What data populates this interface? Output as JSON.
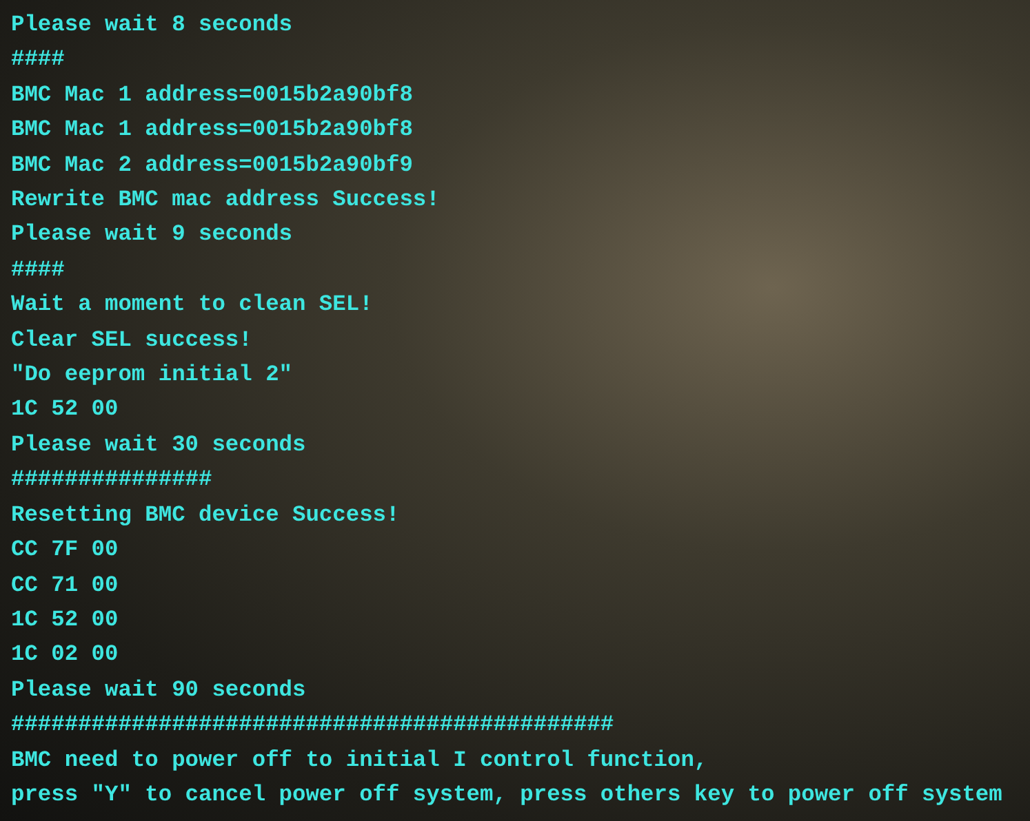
{
  "terminal": {
    "lines": [
      "Please wait 8 seconds",
      "####",
      "BMC Mac 1 address=0015b2a90bf8",
      "BMC Mac 1 address=0015b2a90bf8",
      "BMC Mac 2 address=0015b2a90bf9",
      "Rewrite BMC mac address Success!",
      "Please wait 9 seconds",
      "####",
      "Wait a moment to clean SEL!",
      "Clear SEL success!",
      "\"Do eeprom initial 2\"",
      "1C 52 00",
      "Please wait 30 seconds",
      "###############",
      "Resetting BMC device Success!",
      "CC 7F 00",
      "CC 71 00",
      "1C 52 00",
      "1C 02 00",
      "Please wait 90 seconds",
      "#############################################",
      "BMC need to power off to initial I control function,",
      "press \"Y\" to cancel power off system, press others key to power off system"
    ]
  }
}
